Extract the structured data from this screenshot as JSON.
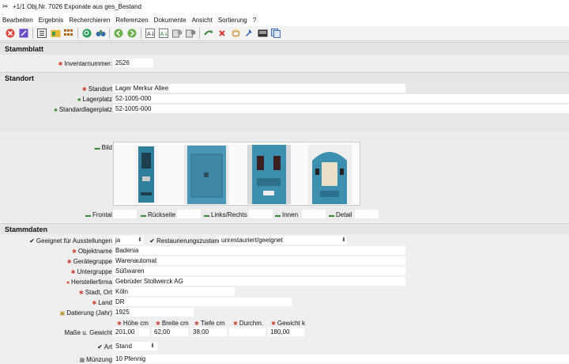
{
  "window": {
    "title": "+1/1  Obj.Nr. 7026  Exponate aus ges_Bestand"
  },
  "menu": [
    "Bearbeiten",
    "Ergebnis",
    "Recherchieren",
    "Referenzen",
    "Dokumente",
    "Ansicht",
    "Sortierung",
    "?"
  ],
  "toolbar": {
    "icons": [
      "close-icon",
      "edit-icon",
      "list-icon",
      "folder-icon",
      "grid-icon",
      "search-icon",
      "binoculars-icon",
      "back-icon",
      "forward-icon",
      "sort-icon",
      "sort-filter-icon",
      "sort-edit-icon",
      "reset-icon",
      "undo-icon",
      "delete-icon",
      "mail-icon",
      "pin-icon",
      "image-icon",
      "copy-icon"
    ]
  },
  "sections": {
    "stammblatt": "Stammblatt",
    "standort": "Standort",
    "stammdaten": "Stammdaten"
  },
  "stammblatt": {
    "inventarnummer_label": "Inventarnummer",
    "inventarnummer": "2526"
  },
  "standort": {
    "standort_label": "Standort",
    "standort": "Lager Merkur Allee",
    "lagerplatz_label": "Lagerplatz",
    "lagerplatz": "52-1005-000",
    "standardlagerplatz_label": "Standardlagerplatz",
    "standardlagerplatz": "52-1005-000"
  },
  "bild": {
    "label": "Bild",
    "views": [
      {
        "label": "Frontal",
        "value": ""
      },
      {
        "label": "Rückseite",
        "value": ""
      },
      {
        "label": "Links/Rechts",
        "value": ""
      },
      {
        "label": "Innen",
        "value": ""
      },
      {
        "label": "Detail",
        "value": ""
      }
    ]
  },
  "stammdaten": {
    "geeignet_label": "Geeignet für Ausstellungen",
    "geeignet": "ja",
    "restaurierung_label": "Restaurierungszustand",
    "restaurierung": "unrestauriert/geeignet",
    "objektname_label": "Objektname",
    "objektname": "Badenia",
    "geraetegruppe_label": "Gerätegruppe",
    "geraetegruppe": "Warenautomat",
    "untergruppe_label": "Untergruppe",
    "untergruppe": "Süßwaren",
    "herstellerfirma_label": "Herstellerfirma",
    "herstellerfirma": "Gebrüder Stollwerck AG",
    "stadt_label": "Stadt, Ort",
    "stadt": "Köln",
    "land_label": "Land",
    "land": "DR",
    "datierung_label": "Datierung (Jahr)",
    "datierung": "1925",
    "masse_label": "Maße u. Gewicht",
    "masse_headers": [
      "Höhe cm",
      "Breite cm",
      "Tiefe cm",
      "Durchm.",
      "Gewicht k"
    ],
    "masse_values": [
      "201,00",
      "62,00",
      "38,00",
      "",
      "180,00"
    ],
    "art_label": "Art",
    "art": "Stand",
    "muenzung_label": "Münzung",
    "muenzung": "10 Pfennig"
  },
  "colors": {
    "background": "#efefef",
    "field": "#ffffff",
    "section_header": "#e4e4e4",
    "cabinet_blue": "#3d8fb0"
  }
}
